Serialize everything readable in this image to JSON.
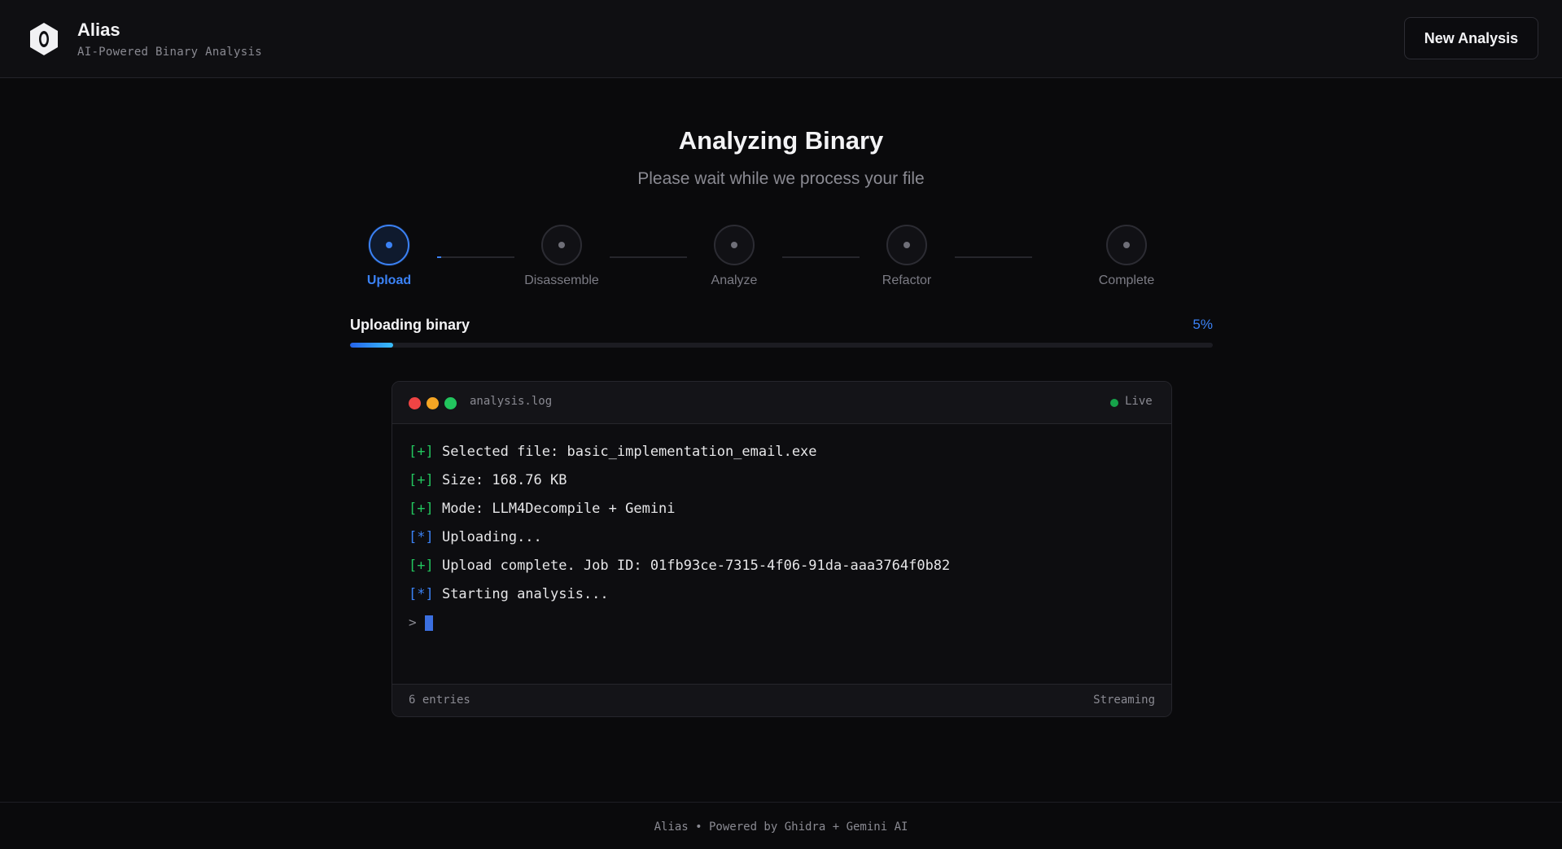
{
  "header": {
    "brand_name": "Alias",
    "brand_tagline": "AI-Powered Binary Analysis",
    "logo_icon": "hexagon-eye-icon",
    "new_analysis_label": "New Analysis"
  },
  "main": {
    "title": "Analyzing Binary",
    "subtitle": "Please wait while we process your file"
  },
  "steps": [
    {
      "label": "Upload",
      "state": "active"
    },
    {
      "label": "Disassemble",
      "state": "pending"
    },
    {
      "label": "Analyze",
      "state": "pending"
    },
    {
      "label": "Refactor",
      "state": "pending"
    },
    {
      "label": "Complete",
      "state": "pending"
    }
  ],
  "progress": {
    "label": "Uploading binary",
    "percent_text": "5%",
    "percent": 5,
    "first_connector_fraction": 0.05
  },
  "terminal": {
    "filename": "analysis.log",
    "status": "Live",
    "lines": [
      {
        "prefix": "[+]",
        "kind": "ok",
        "text": " Selected file: basic_implementation_email.exe"
      },
      {
        "prefix": "[+]",
        "kind": "ok",
        "text": " Size: 168.76 KB"
      },
      {
        "prefix": "[+]",
        "kind": "ok",
        "text": " Mode: LLM4Decompile + Gemini"
      },
      {
        "prefix": "[*]",
        "kind": "info",
        "text": " Uploading..."
      },
      {
        "prefix": "[+]",
        "kind": "ok",
        "text": " Upload complete. Job ID: 01fb93ce-7315-4f06-91da-aaa3764f0b82"
      },
      {
        "prefix": "[*]",
        "kind": "info",
        "text": " Starting analysis..."
      }
    ],
    "prompt": ">",
    "entries_text": "6 entries",
    "stream_status": "Streaming"
  },
  "footer": {
    "text": "Alias • Powered by Ghidra + Gemini AI"
  },
  "colors": {
    "accent": "#3b82f6",
    "ok": "#22c55e",
    "live": "#16a34a",
    "traffic_red": "#ef4444",
    "traffic_yellow": "#f5a524",
    "traffic_green": "#22c55e"
  }
}
